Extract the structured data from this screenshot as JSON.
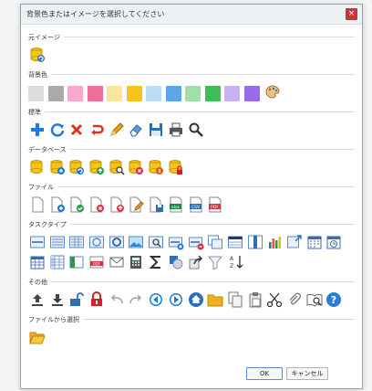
{
  "dialog": {
    "title": "背景色またはイメージを選択してください",
    "close_glyph": "×"
  },
  "sections": {
    "original": "元イメージ",
    "bgcolor": "背景色",
    "standard": "標準",
    "database": "データベース",
    "file": "ファイル",
    "tasktype": "タスクタイプ",
    "other": "その他",
    "fromfile": "ファイルから選択"
  },
  "colors": [
    "#dcdcdc",
    "#aaaaaa",
    "#f7a8cc",
    "#ef6f9b",
    "#fbe59a",
    "#f7c31f",
    "#bcdcf6",
    "#5aa6e8",
    "#9fe0a6",
    "#3dbe59",
    "#c8b2f0",
    "#9a6be8"
  ],
  "icon_names": {
    "standard": [
      "plus-icon",
      "refresh-icon",
      "delete-x-icon",
      "undo-arrow-icon",
      "pencil-icon",
      "eraser-icon",
      "save-icon",
      "print-icon",
      "search-icon"
    ],
    "database": [
      "database-icon",
      "database-add-icon",
      "database-refresh-icon",
      "database-upload-icon",
      "database-search-icon",
      "database-delete-icon",
      "database-settings-icon",
      "database-lock-icon"
    ],
    "file": [
      "file-icon",
      "file-add-icon",
      "file-check-icon",
      "file-delete-icon",
      "file-upload-icon",
      "file-edit-icon",
      "file-save-icon",
      "xlsx-file-icon",
      "csv-file-icon",
      "pdf-file-icon"
    ]
  },
  "file_labels": {
    "xlsx": "xlsx",
    "csv": "CSV",
    "pdf": "PDF",
    "pdf2": "PDF"
  },
  "buttons": {
    "ok": "OK",
    "cancel": "キャンセル"
  }
}
